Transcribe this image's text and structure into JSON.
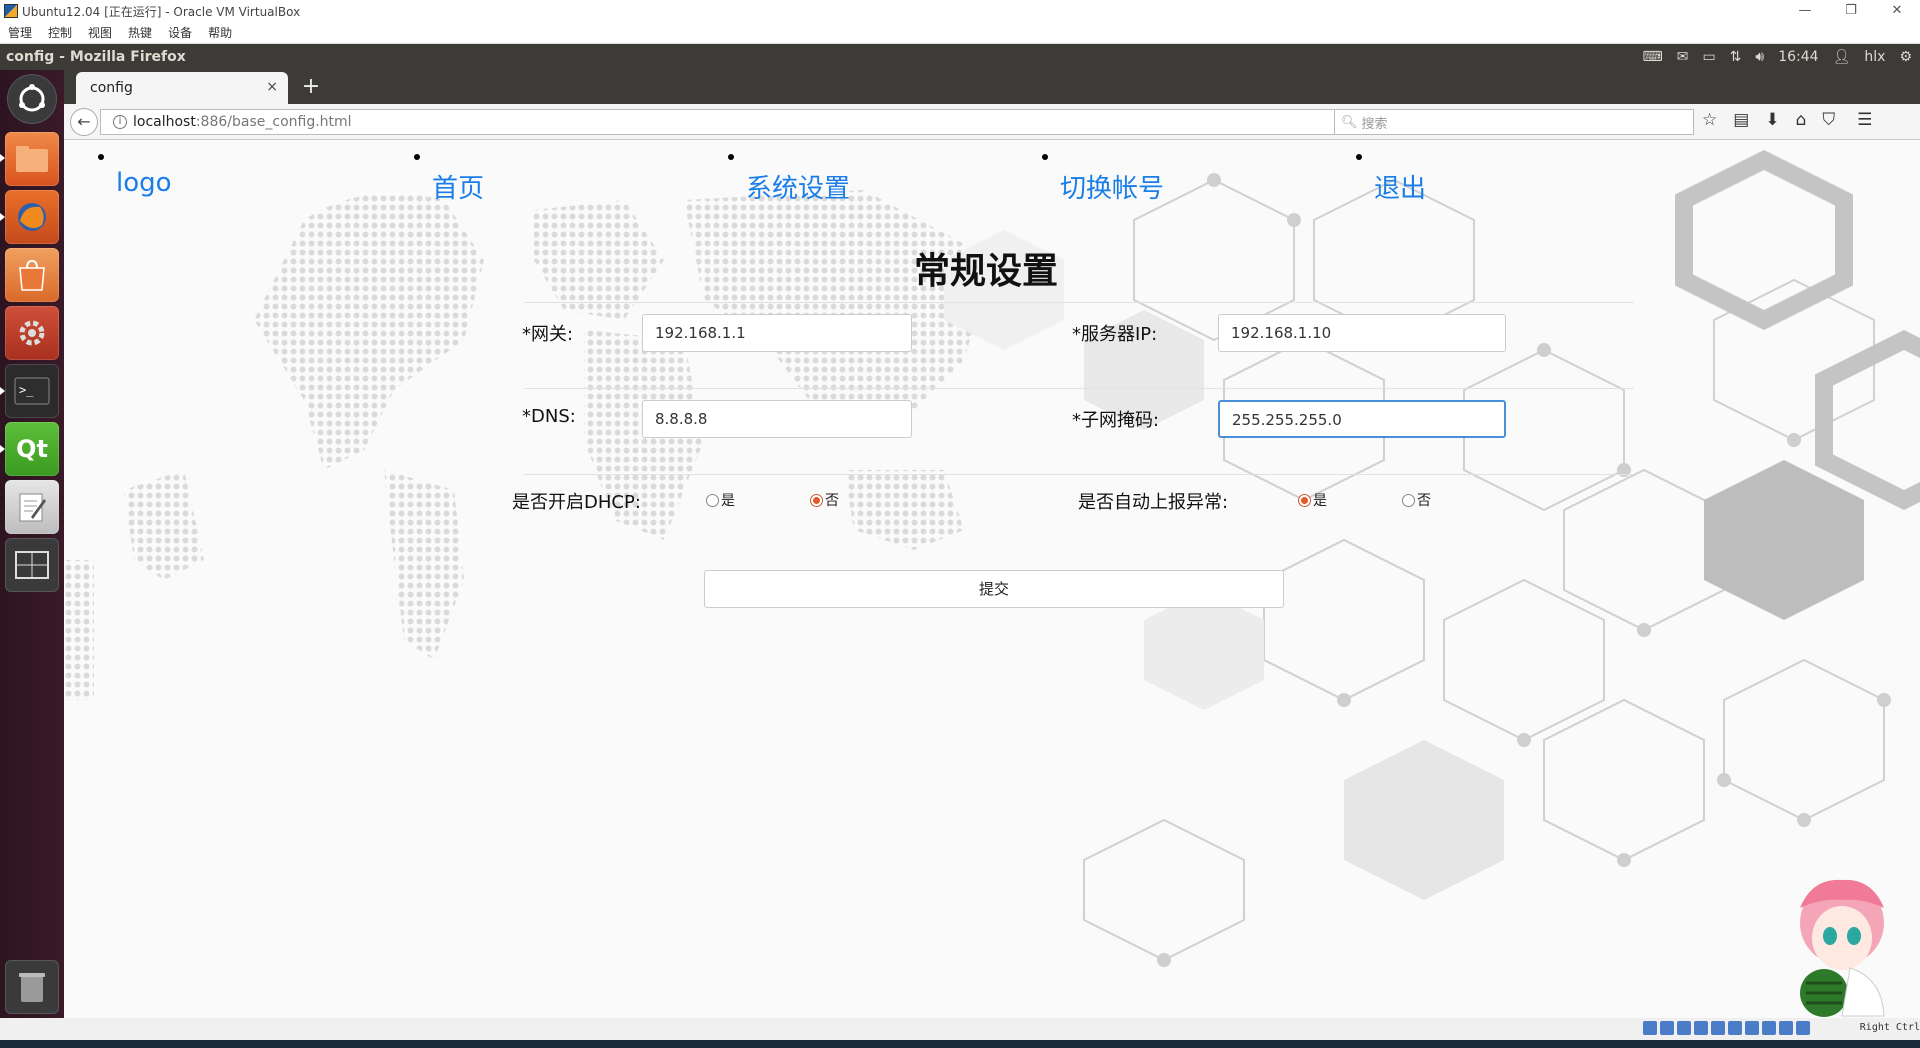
{
  "vbox": {
    "title": "Ubuntu12.04 [正在运行] - Oracle VM VirtualBox",
    "menu": [
      "管理",
      "控制",
      "视图",
      "热键",
      "设备",
      "帮助"
    ],
    "window_controls": [
      "—",
      "❐",
      "✕"
    ],
    "status_hostkey": "Right Ctrl"
  },
  "ubuntu_panel": {
    "window_title": "config - Mozilla Firefox",
    "time": "16:44",
    "user": "hlx"
  },
  "launcher": {
    "items": [
      "dash-home",
      "files",
      "firefox",
      "software-center",
      "system-settings",
      "terminal",
      "qt-creator",
      "text-editor",
      "workspace-switcher",
      "trash"
    ]
  },
  "browser": {
    "tab_title": "config",
    "tab_close": "×",
    "new_tab": "+",
    "url_host": "localhost",
    "url_path": ":886/base_config.html",
    "search_placeholder": "搜索"
  },
  "page": {
    "nav": [
      "logo",
      "首页",
      "系统设置",
      "切换帐号",
      "退出"
    ],
    "title": "常规设置",
    "gateway_label": "*网关:",
    "gateway_value": "192.168.1.1",
    "server_ip_label": "*服务器IP:",
    "server_ip_value": "192.168.1.10",
    "dns_label": "*DNS:",
    "dns_value": "8.8.8.8",
    "subnet_label": "*子网掩码:",
    "subnet_value": "255.255.255.0",
    "dhcp_label": "是否开启DHCP:",
    "dhcp_yes": "是",
    "dhcp_no": "否",
    "dhcp_selected": "否",
    "auto_report_label": "是否自动上报异常:",
    "auto_report_yes": "是",
    "auto_report_no": "否",
    "auto_report_selected": "是",
    "submit": "提交"
  }
}
